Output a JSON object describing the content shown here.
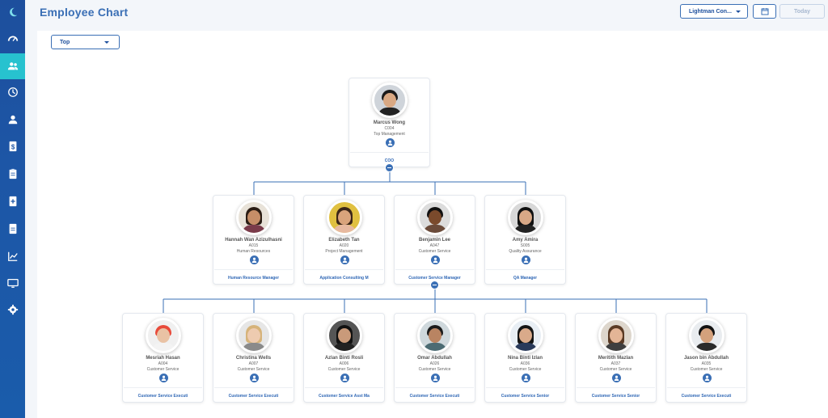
{
  "header": {
    "title": "Employee Chart",
    "company_select": "Lightman Con...",
    "today_label": "Today"
  },
  "filter": {
    "level_select": "Top"
  },
  "sidebar": {
    "items": [
      {
        "name": "logo-moon-icon"
      },
      {
        "name": "dashboard-gauge-icon"
      },
      {
        "name": "employees-icon",
        "active": true
      },
      {
        "name": "clock-history-icon"
      },
      {
        "name": "user-profile-icon"
      },
      {
        "name": "dollar-document-icon"
      },
      {
        "name": "clipboard-icon"
      },
      {
        "name": "add-document-icon"
      },
      {
        "name": "document-icon"
      },
      {
        "name": "line-chart-icon"
      },
      {
        "name": "monitor-icon"
      },
      {
        "name": "settings-icon"
      }
    ]
  },
  "colors": {
    "primary": "#3a6fb5",
    "sidebar": "#1d56a6",
    "active": "#27c2cf"
  },
  "org": {
    "top": {
      "name": "Marcus Wong",
      "code": "C004",
      "dept": "Top Management",
      "position": "COO"
    },
    "level2": [
      {
        "name": "Hannah Wan Azizulhasni",
        "code": "A015",
        "dept": "Human Resources",
        "position": "Human Resource Manager"
      },
      {
        "name": "Elizabeth Tan",
        "code": "A020",
        "dept": "Project Management",
        "position": "Application Consulting M"
      },
      {
        "name": "Benjamin Lee",
        "code": "A047",
        "dept": "Customer Service",
        "position": "Customer Service Manager"
      },
      {
        "name": "Amy Amira",
        "code": "S005",
        "dept": "Quality Assurance",
        "position": "QA Manager"
      }
    ],
    "level3": [
      {
        "name": "Mesriah Hasan",
        "code": "A004",
        "dept": "Customer Service",
        "position": "Customer Service Executi"
      },
      {
        "name": "Christina Wells",
        "code": "A007",
        "dept": "Customer Service",
        "position": "Customer Service Executi"
      },
      {
        "name": "Azlan Binti Rosli",
        "code": "A006",
        "dept": "Customer Service",
        "position": "Customer Service Asst Ma"
      },
      {
        "name": "Omar Abdullah",
        "code": "A026",
        "dept": "Customer Service",
        "position": "Customer Service Executi"
      },
      {
        "name": "Nina Binti Izlan",
        "code": "A036",
        "dept": "Customer Service",
        "position": "Customer Service Senior"
      },
      {
        "name": "Meritith Mazlan",
        "code": "A037",
        "dept": "Customer Service",
        "position": "Customer Service Senior"
      },
      {
        "name": "Jason bin Abdullah",
        "code": "A035",
        "dept": "Customer Service",
        "position": "Customer Service Executi"
      }
    ]
  }
}
